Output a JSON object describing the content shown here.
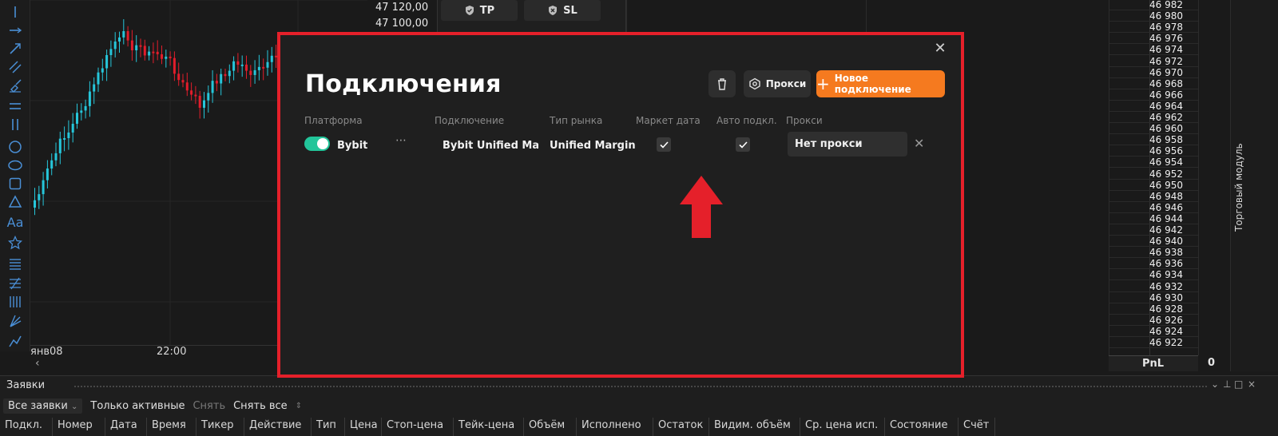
{
  "toolbar": {
    "tools": [
      "vertical-line-icon",
      "horizontal-ray-icon",
      "trend-arrow-icon",
      "parallel-lines-icon",
      "brush-icon",
      "horizontal-lines-icon",
      "vertical-lines-icon",
      "circle-icon",
      "ellipse-icon",
      "rectangle-icon",
      "triangle-icon",
      "text-icon",
      "star-icon",
      "fibonacci-levels-icon",
      "fibonacci-fan-icon",
      "gann-icon",
      "pitchfork-icon",
      "polyline-icon"
    ],
    "text_tool_label": "Aa"
  },
  "chart": {
    "time_labels": [
      "янв08",
      "22:00"
    ],
    "up_color": "#26c6da",
    "down_color": "#e21d2b"
  },
  "order_book": {
    "prices": [
      "47 120,00",
      "47 100,00"
    ],
    "tp_label": "TP",
    "sl_label": "SL"
  },
  "ladder": {
    "prices": [
      "46 982",
      "46 980",
      "46 978",
      "46 976",
      "46 974",
      "46 972",
      "46 970",
      "46 968",
      "46 966",
      "46 964",
      "46 962",
      "46 960",
      "46 958",
      "46 956",
      "46 954",
      "46 952",
      "46 950",
      "46 948",
      "46 946",
      "46 944",
      "46 942",
      "46 940",
      "46 938",
      "46 936",
      "46 934",
      "46 932",
      "46 930",
      "46 928",
      "46 926",
      "46 924",
      "46 922"
    ],
    "pnl_label": "PnL",
    "pnl_value": "0"
  },
  "side_tab": {
    "label": "Торговый модуль"
  },
  "orders": {
    "title": "Заявки",
    "filter_all": "Все заявки",
    "filter_active": "Только активные",
    "cancel": "Снять",
    "cancel_all": "Снять все",
    "columns": [
      "Подкл.",
      "Номер",
      "Дата",
      "Время",
      "Тикер",
      "Действие",
      "Тип",
      "Цена",
      "Стоп-цена",
      "Тейк-цена",
      "Объём",
      "Исполнено",
      "Остаток",
      "Видим. объём",
      "Ср. цена исп.",
      "Состояние",
      "Счёт"
    ]
  },
  "modal": {
    "title": "Подключения",
    "proxy_button": "Прокси",
    "new_connection_button": "Новое подключение",
    "accent_color": "#f57a1f",
    "headers": {
      "platform": "Платформа",
      "connection": "Подключение",
      "market_type": "Тип рынка",
      "market_data": "Маркет дата",
      "auto_connect": "Авто подкл.",
      "proxy": "Прокси"
    },
    "row": {
      "platform": "Bybit",
      "enabled": true,
      "connection": "Bybit Unified Ma",
      "market_type": "Unified Margin",
      "market_data": true,
      "auto_connect": true,
      "proxy": "Нет прокси"
    }
  }
}
